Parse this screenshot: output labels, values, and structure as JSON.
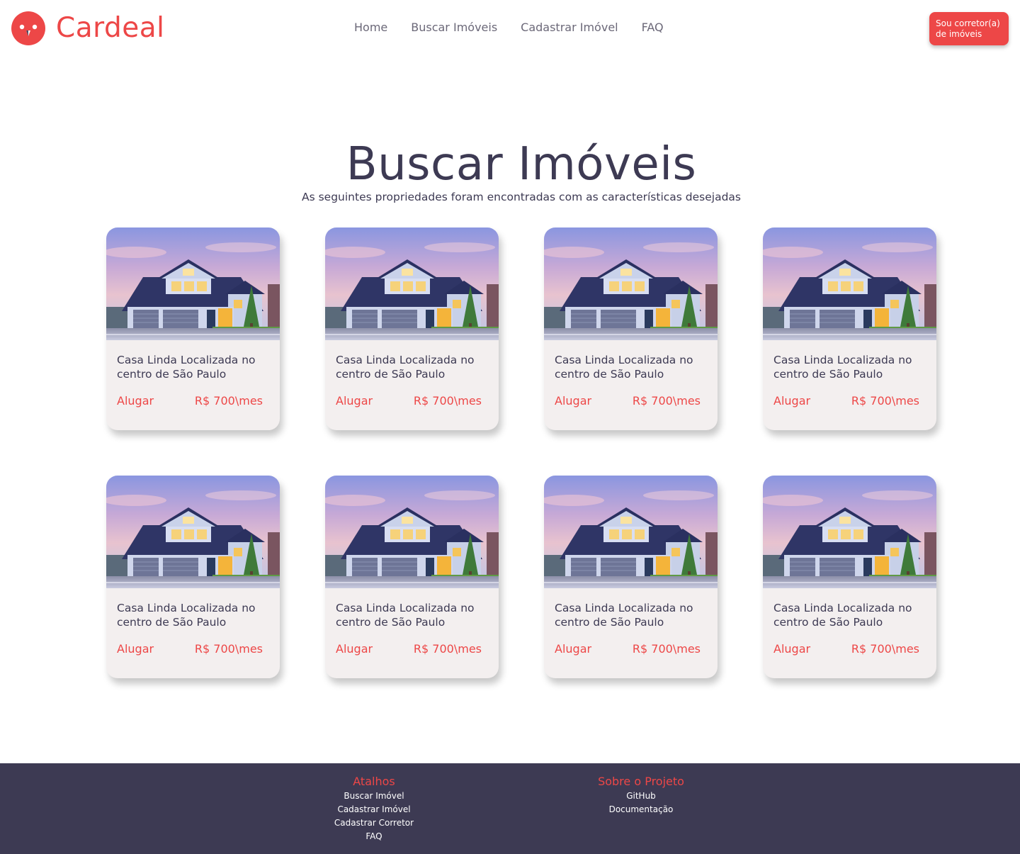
{
  "brand": {
    "name": "Cardeal",
    "accent_color": "#ed4747",
    "dark_color": "#3d3a53"
  },
  "nav": {
    "items": [
      {
        "label": "Home"
      },
      {
        "label": "Buscar Imóveis"
      },
      {
        "label": "Cadastrar Imóvel"
      },
      {
        "label": "FAQ"
      }
    ],
    "broker_button_line1": "Sou corretor(a)",
    "broker_button_line2": "de imóveis"
  },
  "main": {
    "title": "Buscar Imóveis",
    "subtitle": "As seguintes propriedades foram encontradas com as características desejadas",
    "cards": [
      {
        "title": "Casa Linda Localizada  no centro de São Paulo",
        "type": "Alugar",
        "price": "R$ 700\\mes"
      },
      {
        "title": "Casa Linda Localizada  no centro de São Paulo",
        "type": "Alugar",
        "price": "R$ 700\\mes"
      },
      {
        "title": "Casa Linda Localizada  no centro de São Paulo",
        "type": "Alugar",
        "price": "R$ 700\\mes"
      },
      {
        "title": "Casa Linda Localizada  no centro de São Paulo",
        "type": "Alugar",
        "price": "R$ 700\\mes"
      },
      {
        "title": "Casa Linda Localizada  no centro de São Paulo",
        "type": "Alugar",
        "price": "R$ 700\\mes"
      },
      {
        "title": "Casa Linda Localizada  no centro de São Paulo",
        "type": "Alugar",
        "price": "R$ 700\\mes"
      },
      {
        "title": "Casa Linda Localizada  no centro de São Paulo",
        "type": "Alugar",
        "price": "R$ 700\\mes"
      },
      {
        "title": "Casa Linda Localizada  no centro de São Paulo",
        "type": "Alugar",
        "price": "R$ 700\\mes"
      }
    ]
  },
  "footer": {
    "shortcuts": {
      "heading": "Atalhos",
      "links": [
        "Buscar Imóvel",
        "Cadastrar Imóvel",
        "Cadastrar Corretor",
        "FAQ"
      ]
    },
    "about": {
      "heading": "Sobre o Projeto",
      "links": [
        "GitHub",
        "Documentação"
      ]
    }
  }
}
